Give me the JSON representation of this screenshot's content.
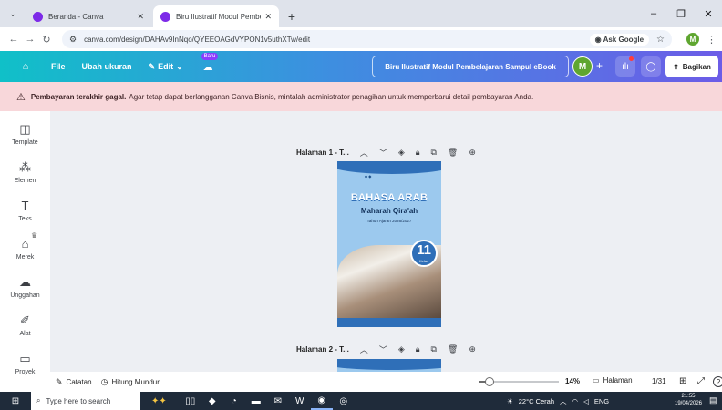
{
  "browser": {
    "tabs": [
      {
        "title": "Beranda - Canva",
        "active": false
      },
      {
        "title": "Biru Ilustratif Modul Pembelajar",
        "active": true
      }
    ],
    "url": "canva.com/design/DAHAv9InNqo/QYEEOAGdVYPON1v5uthXTw/edit",
    "ask_google": "Ask Google",
    "profile_initial": "M"
  },
  "header": {
    "file": "File",
    "resize": "Ubah ukuran",
    "edit": "Edit",
    "new_badge": "Baru",
    "doc_title": "Biru Ilustratif Modul Pembelajaran Sampul eBook",
    "avatar": "M",
    "share": "Bagikan"
  },
  "banner": {
    "strong": "Pembayaran terakhir gagal.",
    "text": "Agar tetap dapat berlangganan Canva Bisnis, mintalah administrator penagihan untuk memperbarui detail pembayaran Anda."
  },
  "sidebar": {
    "items": [
      {
        "label": "Template"
      },
      {
        "label": "Elemen"
      },
      {
        "label": "Teks"
      },
      {
        "label": "Merek"
      },
      {
        "label": "Unggahan"
      },
      {
        "label": "Alat"
      },
      {
        "label": "Proyek"
      }
    ]
  },
  "pages": [
    {
      "label": "Halaman 1 - T..."
    },
    {
      "label": "Halaman 2 - T..."
    }
  ],
  "cover": {
    "title": "BAHASA ARAB",
    "subtitle": "Maharah Qira'ah",
    "year": "Tahun Ajaran 2026/2027",
    "grade": "11",
    "grade_label": "Kelas"
  },
  "footer": {
    "notes": "Catatan",
    "timer": "Hitung Mundur",
    "zoom_percent": 14,
    "zoom": "14%",
    "pages_label": "Halaman",
    "page_count": "1/31"
  },
  "taskbar": {
    "search_placeholder": "Type here to search",
    "weather": "22°C  Cerah",
    "lang": "ENG",
    "time": "21:55",
    "date": "19/04/2026"
  }
}
